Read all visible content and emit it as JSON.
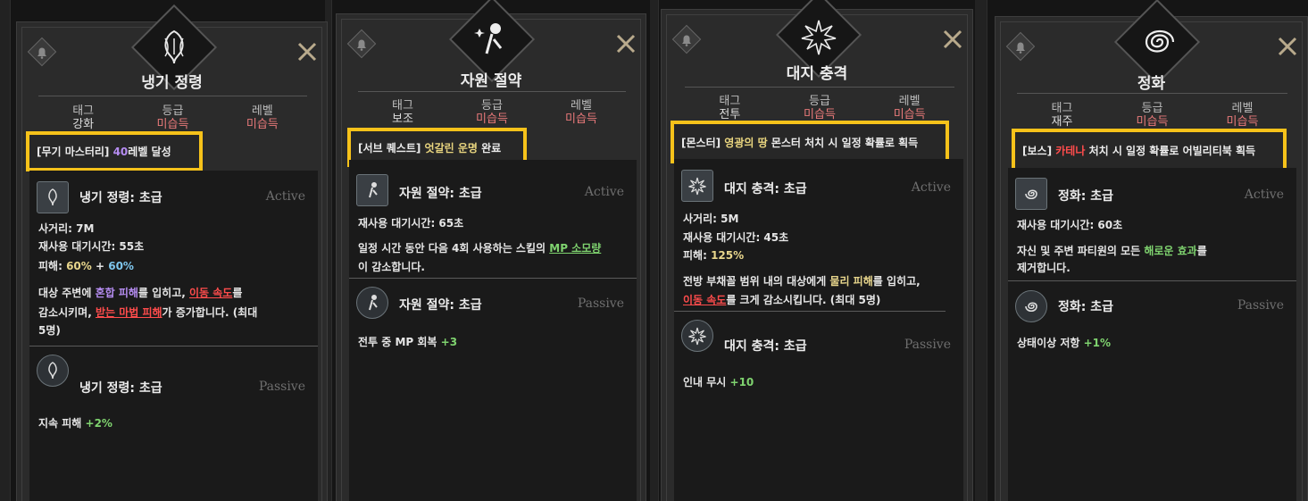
{
  "labels": {
    "tag": "태그",
    "grade": "등급",
    "level": "레벨",
    "active": "Active",
    "passive": "Passive"
  },
  "cards": [
    {
      "title": "냉기 정령",
      "tag": "강화",
      "grade": "미습득",
      "level": "미습득",
      "requirement": {
        "bracket": "[무기 마스터리]",
        "highlight": "40",
        "rest": "레벨 달성"
      },
      "active": {
        "name": "냉기 정령: 초급",
        "range": "사거리: 7M",
        "cooldown": "재사용 대기시간: 55초",
        "dmg_prefix": "피해: ",
        "dmg_a": "60%",
        "dmg_plus": " + ",
        "dmg_b": "60%",
        "d1a": "대상 주변에 ",
        "d1b": "혼합 피해",
        "d1c": "를 입히고, ",
        "d1d": "이동 속도",
        "d1e": "를",
        "d2a": "감소시키며, ",
        "d2b": "받는 마법 피해",
        "d2c": "가 증가합니다. (최대",
        "d3": "5명)"
      },
      "passive": {
        "name": "냉기 정령: 초급",
        "label": "지속 피해 ",
        "value": "+2%"
      }
    },
    {
      "title": "자원 절약",
      "tag": "보조",
      "grade": "미습득",
      "level": "미습득",
      "requirement": {
        "bracket": "[서브 퀘스트]",
        "highlight": "엇갈린 운명",
        "rest": "완료"
      },
      "active": {
        "name": "자원 절약: 초급",
        "cooldown": "재사용 대기시간: 65초",
        "d1a": "일정 시간 동안 다음 4회 사용하는 스킬의 ",
        "d1b": "MP 소모량",
        "d2": "이 감소합니다."
      },
      "passive": {
        "name": "자원 절약: 초급",
        "label": "전투 중 MP 회복 ",
        "value": "+3"
      }
    },
    {
      "title": "대지 충격",
      "tag": "전투",
      "grade": "미습득",
      "level": "미습득",
      "requirement": {
        "bracket": "[몬스터]",
        "highlight": "영광의 땅",
        "rest": "몬스터 처치 시 일정 확률로 획득"
      },
      "active": {
        "name": "대지 충격: 초급",
        "range": "사거리: 5M",
        "cooldown": "재사용 대기시간: 45초",
        "dmg_prefix": "피해: ",
        "dmg_a": "125%",
        "d1a": "전방 부채꼴 범위 내의 대상에게 ",
        "d1b": "물리 피해",
        "d1c": "를 입히고,",
        "d2a": "이동 속도",
        "d2b": "를 크게 감소시킵니다. (최대 5명)"
      },
      "passive": {
        "name": "대지 충격: 초급",
        "label": "인내 무시 ",
        "value": "+10"
      }
    },
    {
      "title": "정화",
      "tag": "재주",
      "grade": "미습득",
      "level": "미습득",
      "requirement": {
        "bracket": "[보스]",
        "highlight": "카테나",
        "rest": "처치 시 일정 확률로 어빌리티북 획득"
      },
      "active": {
        "name": "정화: 초급",
        "cooldown": "재사용 대기시간: 60초",
        "d1a": "자신 및 주변 파티원의 모든 ",
        "d1b": "해로운 효과",
        "d1c": "를",
        "d2": "제거합니다."
      },
      "passive": {
        "name": "정화: 초급",
        "label": "상태이상 저항 ",
        "value": "+1%"
      }
    }
  ]
}
